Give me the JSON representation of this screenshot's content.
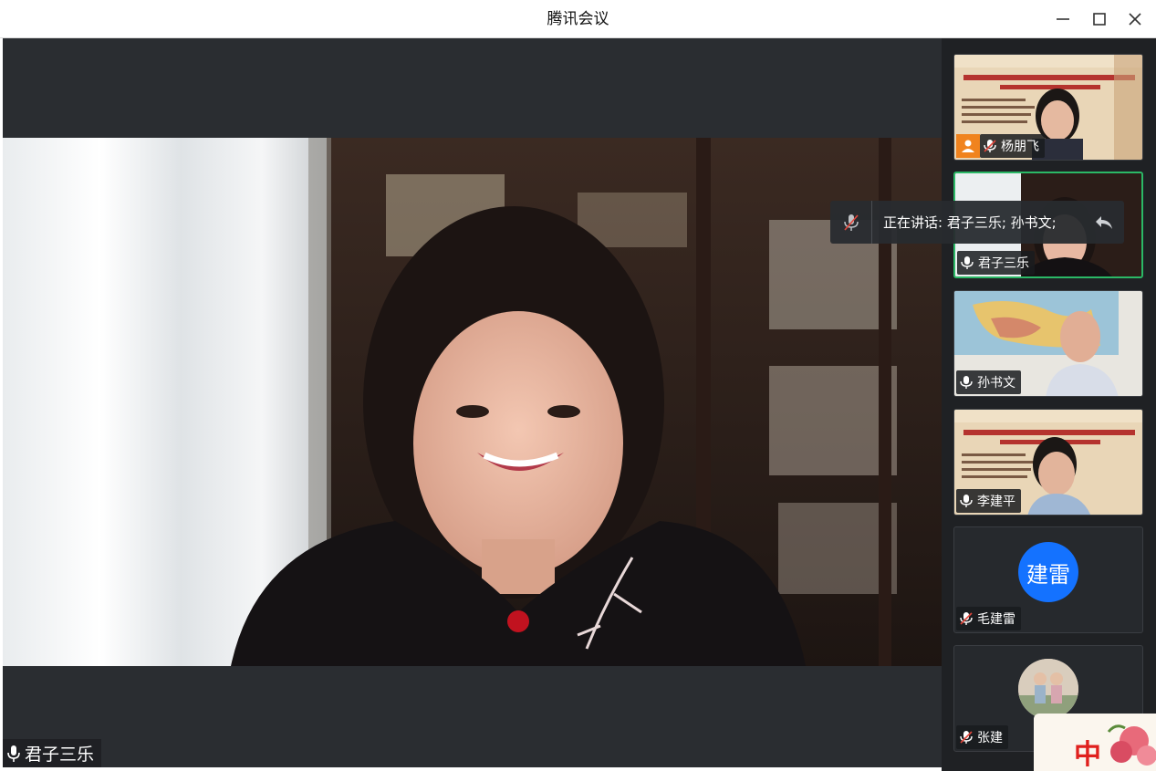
{
  "window": {
    "title": "腾讯会议"
  },
  "main": {
    "speaker_name": "君子三乐"
  },
  "speaking_banner": {
    "text": "正在讲话: 君子三乐; 孙书文;"
  },
  "participants": [
    {
      "name": "杨朋飞",
      "mic": "muted",
      "has_badge": true,
      "view": "slides-with-face"
    },
    {
      "name": "君子三乐",
      "mic": "on",
      "has_badge": false,
      "view": "video",
      "active": true
    },
    {
      "name": "孙书文",
      "mic": "on",
      "has_badge": false,
      "view": "video-map"
    },
    {
      "name": "李建平",
      "mic": "on",
      "has_badge": false,
      "view": "slides-with-face"
    },
    {
      "name": "毛建雷",
      "mic": "muted",
      "has_badge": false,
      "view": "avatar",
      "avatar_text": "建雷"
    },
    {
      "name": "张建",
      "mic": "muted",
      "has_badge": false,
      "view": "avatar-photo"
    }
  ],
  "sticker": {
    "text": "中"
  },
  "colors": {
    "accent_active": "#2bb866",
    "avatar_blue": "#1472ff",
    "badge_orange": "#f0831e",
    "stage_bg": "#2a2d31"
  }
}
